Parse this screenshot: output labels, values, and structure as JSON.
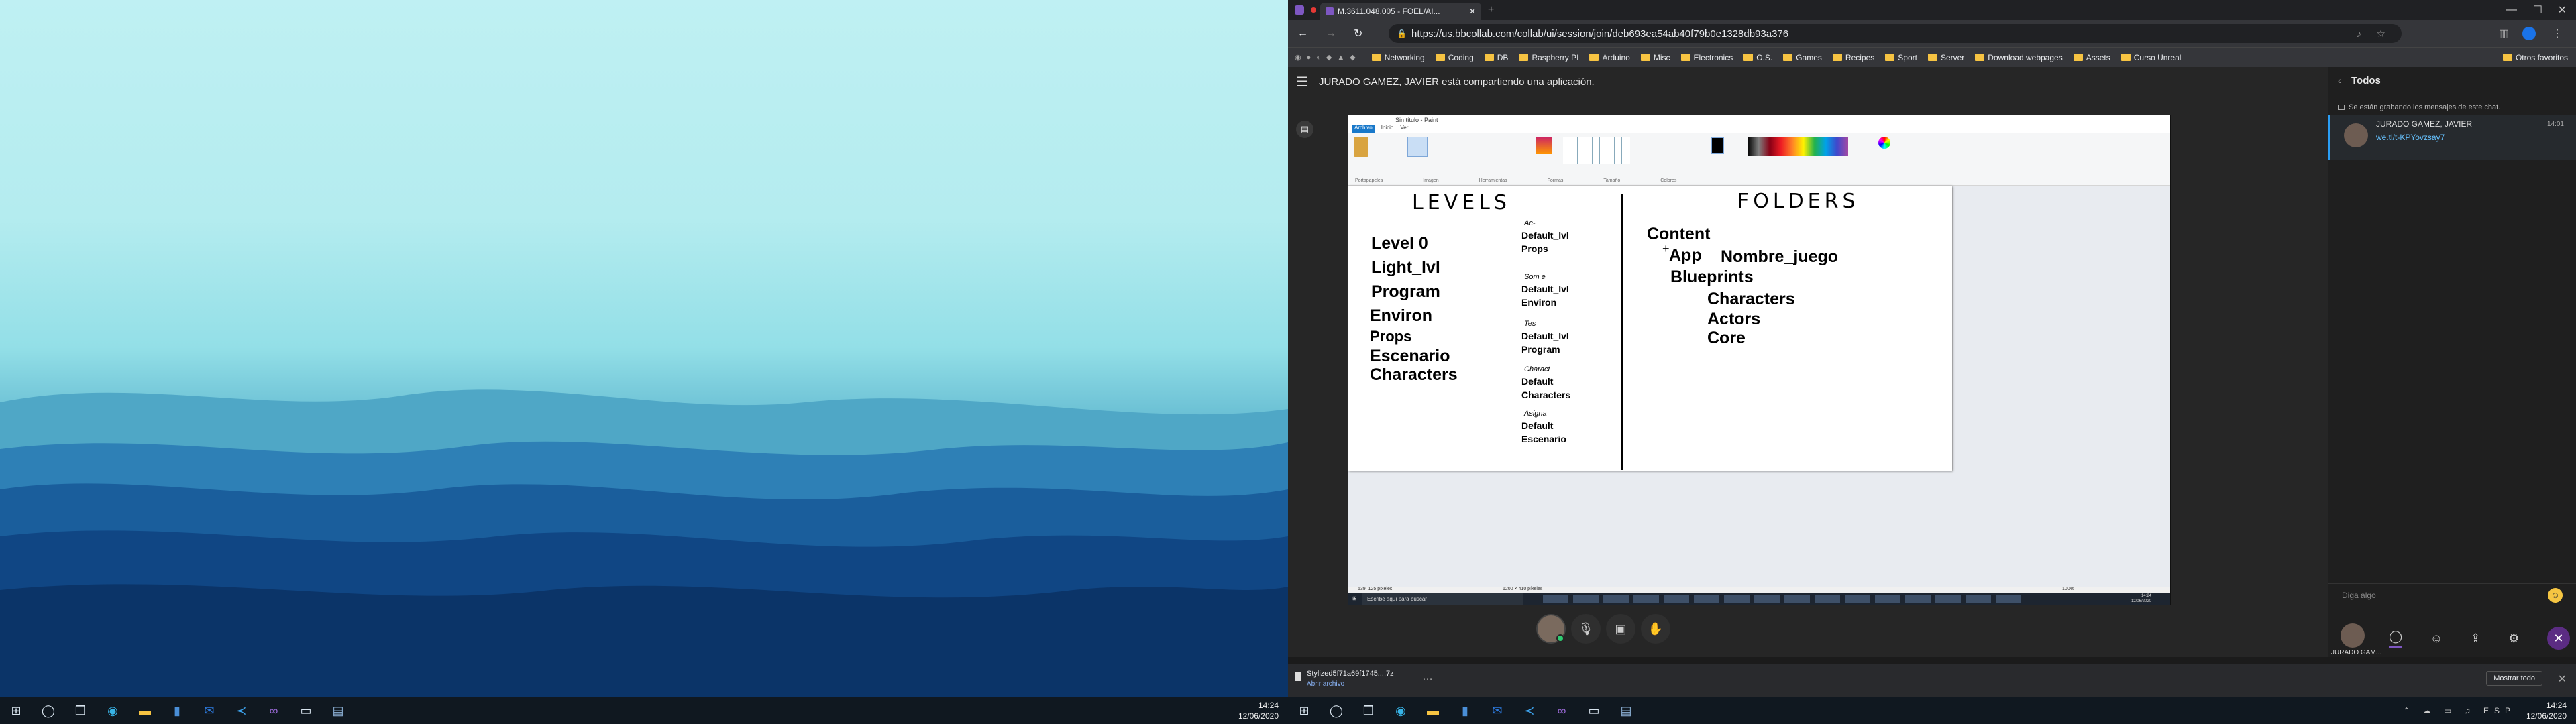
{
  "left_monitor": {
    "clock": {
      "time": "14:24",
      "date": "12/06/2020"
    },
    "taskbar_icons": [
      "windows-start-icon",
      "search-icon",
      "task-view-icon",
      "edge-browser-icon",
      "file-explorer-icon",
      "word-document-icon",
      "outlook-icon",
      "visual-studio-code-icon",
      "visual-studio-icon",
      "terminal-icon",
      "window-icon"
    ]
  },
  "right_monitor": {
    "browser": {
      "tab_title": "M.3611.048.005 - FOEL/AI...",
      "new_tab": "+",
      "url": "https://us.bbcollab.com/collab/ui/session/join/deb693ea54ab40f79b0e1328db93a376",
      "bookmarks": [
        "Networking",
        "Coding",
        "DB",
        "Raspberry PI",
        "Arduino",
        "Misc",
        "Electronics",
        "O.S.",
        "Games",
        "Recipes",
        "Sport",
        "Server",
        "Download webpages",
        "Assets",
        "Curso Unreal"
      ],
      "other_bookmarks": "Otros favoritos"
    },
    "session": {
      "share_banner": "JURADO GAMEZ, JAVIER está compartiendo una aplicación.",
      "paint": {
        "title": "Sin título - Paint",
        "menu": [
          "Archivo",
          "Inicio",
          "Ver"
        ],
        "ribbon_groups": [
          "Portapapeles",
          "Imagen",
          "Herramientas",
          "Formas",
          "Tamaño",
          "Colores"
        ],
        "status_left": "539, 125 píxeles",
        "status_mid": "1200 × 410 píxeles",
        "status_zoom": "100%",
        "canvas": {
          "left_heading": "LEVELS",
          "right_heading": "FOLDERS",
          "levels": [
            "Level 0",
            "Light_lvl",
            "Program",
            "Environ",
            "Props",
            "Escenario",
            "Characters"
          ],
          "level_pairs": [
            {
              "hand": "Ac-",
              "line1": "Default_lvl",
              "line2": "Props"
            },
            {
              "hand": "Som e",
              "line1": "Default_lvl",
              "line2": "Environ"
            },
            {
              "hand": "Tes",
              "line1": "Default_lvl",
              "line2": "Program"
            },
            {
              "hand": "Charact",
              "line1": "Default",
              "line2": "Characters"
            },
            {
              "hand": "Asigna",
              "line1": "Default",
              "line2": "Escenario"
            }
          ],
          "folders": {
            "content": "Content",
            "app": "App",
            "nombre": "Nombre_juego",
            "blueprints": "Blueprints",
            "characters": "Characters",
            "actors": "Actors",
            "core": "Core"
          }
        },
        "taskbar_search": "Escribe aquí para buscar",
        "clock": {
          "time": "14:24",
          "date": "12/06/2020"
        }
      }
    },
    "chat": {
      "header": "Todos",
      "recording_notice": "Se están grabando los mensajes de este chat.",
      "message": {
        "author": "JURADO GAMEZ, JAVIER",
        "time": "14:01",
        "text": "we.tl/t-KPYovzsay7"
      },
      "input_placeholder": "Diga algo",
      "presenter": "JURADO GAM..."
    },
    "download": {
      "filename": "Stylized5f71a69f1745....7z",
      "action": "Abrir archivo",
      "show_all": "Mostrar todo"
    },
    "clock": {
      "time": "14:24",
      "date": "12/06/2020"
    },
    "colors": {
      "accent": "#5b2c83",
      "link": "#66c2ff",
      "folder": "#f6c342"
    }
  }
}
